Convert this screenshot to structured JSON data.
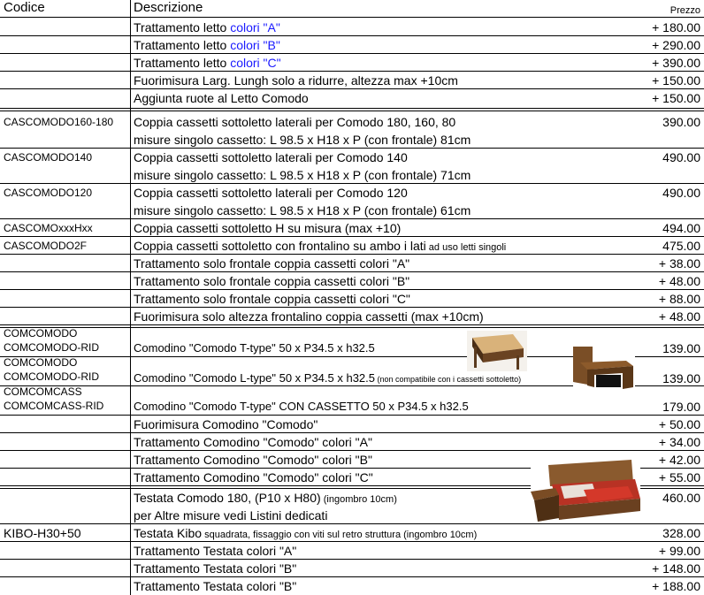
{
  "header": {
    "code": "Codice",
    "description": "Descrizione",
    "price": "Prezzo"
  },
  "rows": [
    {
      "code": "",
      "desc": "Trattamento letto ",
      "desc_blue": "colori \"A\"",
      "price": "+ 180.00"
    },
    {
      "code": "",
      "desc": "Trattamento letto ",
      "desc_blue": "colori \"B\"",
      "price": "+ 290.00"
    },
    {
      "code": "",
      "desc": "Trattamento letto ",
      "desc_blue": "colori \"C\"",
      "price": "+ 390.00"
    },
    {
      "code": "",
      "desc": "Fuorimisura Larg. Lungh solo a ridurre, altezza max +10cm",
      "price": "+ 150.00"
    },
    {
      "code": "",
      "desc": "Aggiunta ruote al Letto Comodo",
      "price": "+ 150.00"
    },
    {
      "code": "CASCOMODO160-180",
      "desc": "Coppia cassetti sottoletto laterali per Comodo 180, 160, 80",
      "desc2": "misure singolo cassetto: L 98.5 x H18 x P (con frontale) 81cm",
      "price": "390.00"
    },
    {
      "code": "CASCOMODO140",
      "desc": "Coppia cassetti sottoletto laterali per Comodo 140",
      "desc2": "misure singolo cassetto: L 98.5 x H18 x P (con frontale) 71cm",
      "price": "490.00"
    },
    {
      "code": "CASCOMODO120",
      "desc": "Coppia cassetti sottoletto laterali per Comodo 120",
      "desc2": "misure singolo cassetto: L 98.5 x H18 x P (con frontale) 61cm",
      "price": "490.00"
    },
    {
      "code": "CASCOMOxxxHxx",
      "desc": "Coppia cassetti sottoletto H su misura (max +10)",
      "price": "494.00"
    },
    {
      "code": "CASCOMODO2F",
      "desc": "Coppia cassetti sottoletto con frontalino su ambo i lati",
      "desc_small": " ad uso letti singoli",
      "price": "475.00"
    },
    {
      "code": "",
      "desc": "Trattamento solo frontale coppia cassetti colori \"A\"",
      "price": "+ 38.00"
    },
    {
      "code": "",
      "desc": "Trattamento solo frontale coppia cassetti colori \"B\"",
      "price": "+ 48.00"
    },
    {
      "code": "",
      "desc": "Trattamento solo frontale coppia cassetti colori \"C\"",
      "price": "+ 88.00"
    },
    {
      "code": "",
      "desc": "Fuorimisura solo altezza frontalino coppia cassetti (max +10cm)",
      "price": "+ 48.00"
    },
    {
      "code": "COMCOMODO",
      "code2": "COMCOMODO-RID",
      "desc": "Comodino \"Comodo T-type\" 50 x P34.5 x h32.5",
      "price": "139.00"
    },
    {
      "code": "COMCOMODO",
      "code2": "COMCOMODO-RID",
      "desc": "Comodino \"Comodo L-type\" 50 x P34.5 x h32.5",
      "desc_small": " (non compatibile con i cassetti sottoletto)",
      "price": "139.00"
    },
    {
      "code": "COMCOMCASS",
      "code2": "COMCOMCASS-RID",
      "desc": "Comodino \"Comodo T-type\" CON CASSETTO 50 x P34.5 x h32.5",
      "price": "179.00"
    },
    {
      "code": "",
      "desc": "Fuorimisura Comodino \"Comodo\"",
      "price": "+ 50.00"
    },
    {
      "code": "",
      "desc": "Trattamento Comodino \"Comodo\" colori \"A\"",
      "price": "+ 34.00"
    },
    {
      "code": "",
      "desc": "Trattamento Comodino \"Comodo\" colori \"B\"",
      "price": "+ 42.00"
    },
    {
      "code": "",
      "desc": "Trattamento Comodino \"Comodo\" colori \"C\"",
      "price": "+ 55.00"
    },
    {
      "code": "",
      "desc": "Testata Comodo 180, (P10 x H80)",
      "desc_small": " (ingombro 10cm)",
      "desc2": "per Altre misure vedi Listini dedicati",
      "price": "460.00"
    },
    {
      "code": "KIBO-H30+50",
      "desc": "Testata Kibo",
      "desc_small": " squadrata, fissaggio con viti sul retro struttura (ingombro 10cm)",
      "price": "328.00"
    },
    {
      "code": "",
      "desc": "Trattamento Testata colori \"A\"",
      "price": "+ 99.00"
    },
    {
      "code": "",
      "desc": "Trattamento Testata colori \"B\"",
      "price": "+ 148.00"
    },
    {
      "code": "",
      "desc": "Trattamento Testata colori \"B\"",
      "price": "+ 188.00"
    }
  ],
  "images": [
    {
      "name": "comodino-t-type-photo",
      "colors": [
        "#c8a06a",
        "#5a3a1e"
      ]
    },
    {
      "name": "comodino-l-type-photo",
      "colors": [
        "#6b4522",
        "#2b1a0c"
      ]
    },
    {
      "name": "testata-bed-photo",
      "colors": [
        "#8a5a2e",
        "#c0282a"
      ]
    }
  ]
}
